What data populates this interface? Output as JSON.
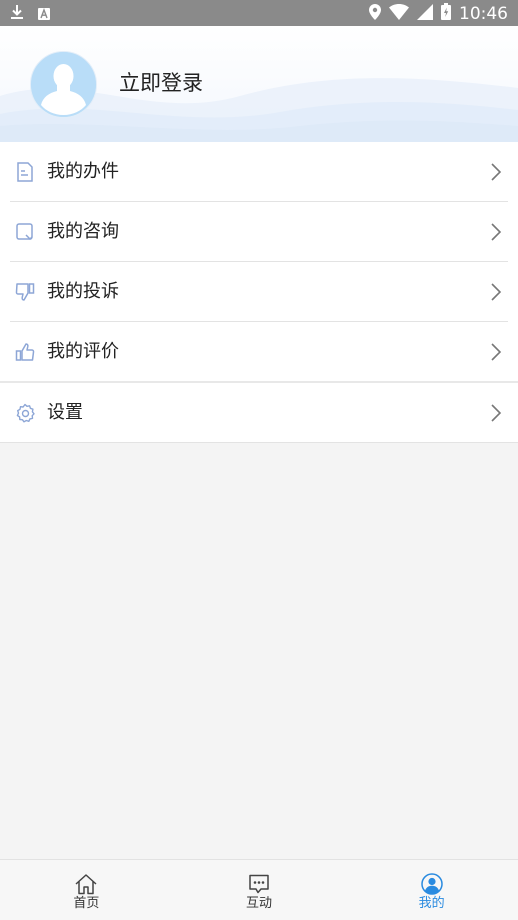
{
  "status_bar": {
    "time": "10:46",
    "left_icons": [
      "download-icon",
      "a-notification-icon"
    ],
    "right_icons": [
      "location-icon",
      "wifi-icon",
      "signal-icon",
      "battery-icon"
    ]
  },
  "profile": {
    "login_label": "立即登录",
    "avatar_icon": "user-avatar-icon"
  },
  "menu": {
    "items": [
      {
        "label": "我的办件",
        "icon": "document-icon"
      },
      {
        "label": "我的咨询",
        "icon": "consult-icon"
      },
      {
        "label": "我的投诉",
        "icon": "thumbs-down-icon"
      },
      {
        "label": "我的评价",
        "icon": "thumbs-up-icon"
      },
      {
        "label": "设置",
        "icon": "gear-icon"
      }
    ]
  },
  "tabs": {
    "items": [
      {
        "label": "首页",
        "icon": "home-icon",
        "active": false
      },
      {
        "label": "互动",
        "icon": "message-icon",
        "active": false
      },
      {
        "label": "我的",
        "icon": "user-icon",
        "active": true
      }
    ]
  },
  "colors": {
    "accent": "#2a8be0",
    "icon": "#8da6d6",
    "status_bar": "#8a8a8a",
    "avatar_bg": "#b9ddf8"
  }
}
